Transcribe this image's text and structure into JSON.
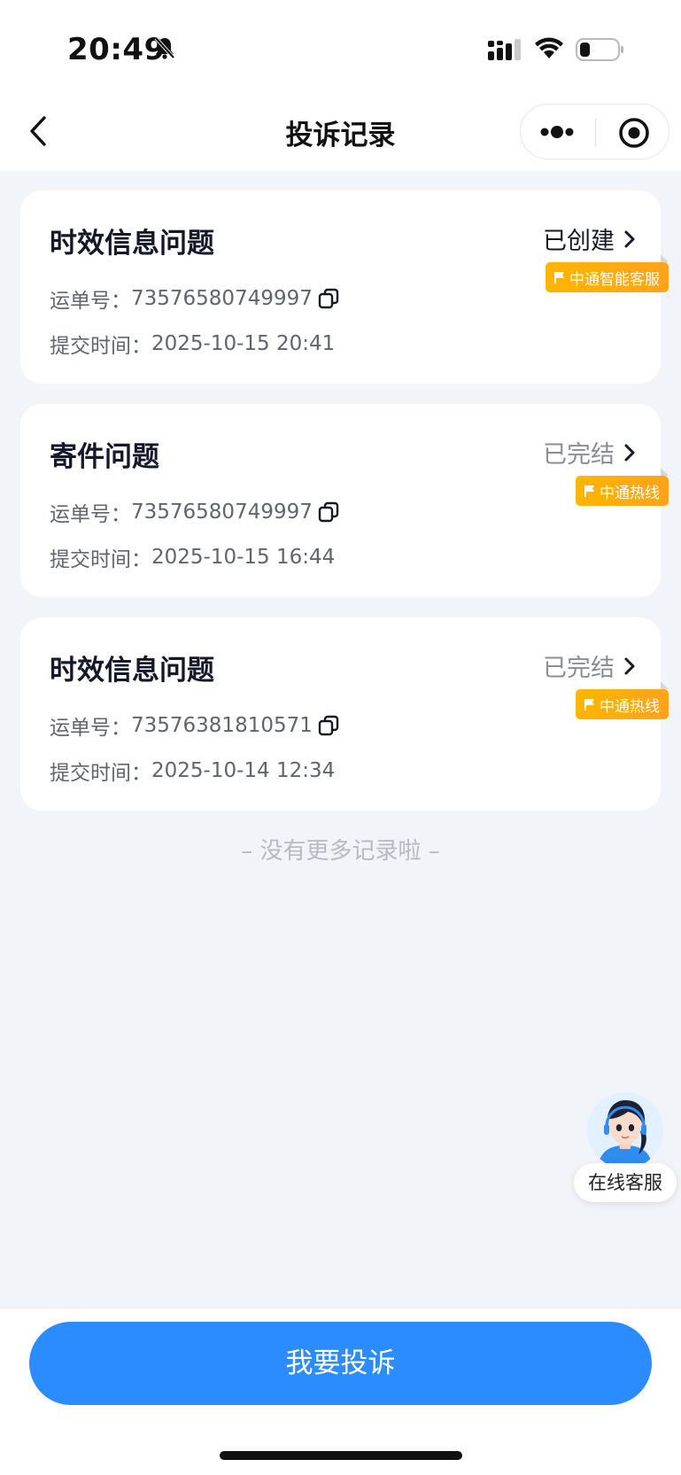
{
  "status_bar": {
    "time": "20:49"
  },
  "nav": {
    "title": "投诉记录"
  },
  "complaints": [
    {
      "title": "时效信息问题",
      "status": "已创建",
      "waybill_label": "运单号：",
      "waybill_no": "73576580749997",
      "submit_label": "提交时间：",
      "submit_time": "2025-10-15 20:41",
      "channel": "中通智能客服"
    },
    {
      "title": "寄件问题",
      "status": "已完结",
      "waybill_label": "运单号：",
      "waybill_no": "73576580749997",
      "submit_label": "提交时间：",
      "submit_time": "2025-10-15 16:44",
      "channel": "中通热线"
    },
    {
      "title": "时效信息问题",
      "status": "已完结",
      "waybill_label": "运单号：",
      "waybill_no": "73576381810571",
      "submit_label": "提交时间：",
      "submit_time": "2025-10-14 12:34",
      "channel": "中通热线"
    }
  ],
  "end_note": "– 没有更多记录啦 –",
  "customer_service": {
    "label": "在线客服"
  },
  "cta": {
    "label": "我要投诉"
  },
  "colors": {
    "primary": "#2b8cff",
    "badge": "#ffb600",
    "background": "#f1f4f8",
    "status_active": "#15182a",
    "status_done": "#8a8d96"
  }
}
